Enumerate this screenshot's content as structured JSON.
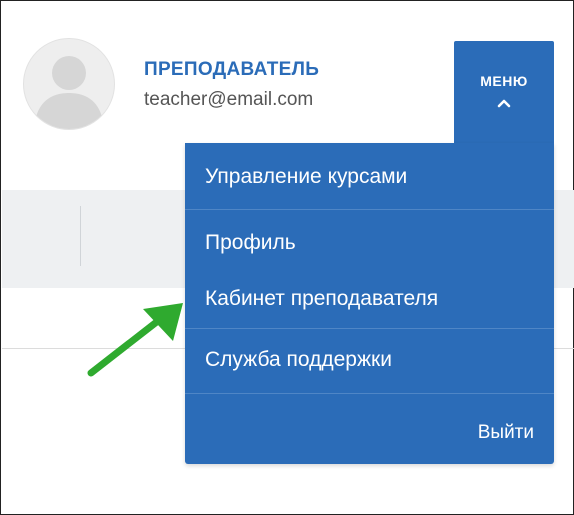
{
  "profile": {
    "role": "ПРЕПОДАВАТЕЛЬ",
    "email": "teacher@email.com",
    "avatar_icon": "user-silhouette-icon"
  },
  "menu_button": {
    "label": "МЕНЮ",
    "icon": "chevron-up-icon"
  },
  "dropdown": {
    "items": [
      "Управление курсами",
      "Профиль",
      "Кабинет преподавателя",
      "Служба поддержки"
    ],
    "logout": "Выйти"
  },
  "colors": {
    "accent": "#2b6cb8",
    "arrow": "#2faa2f"
  }
}
